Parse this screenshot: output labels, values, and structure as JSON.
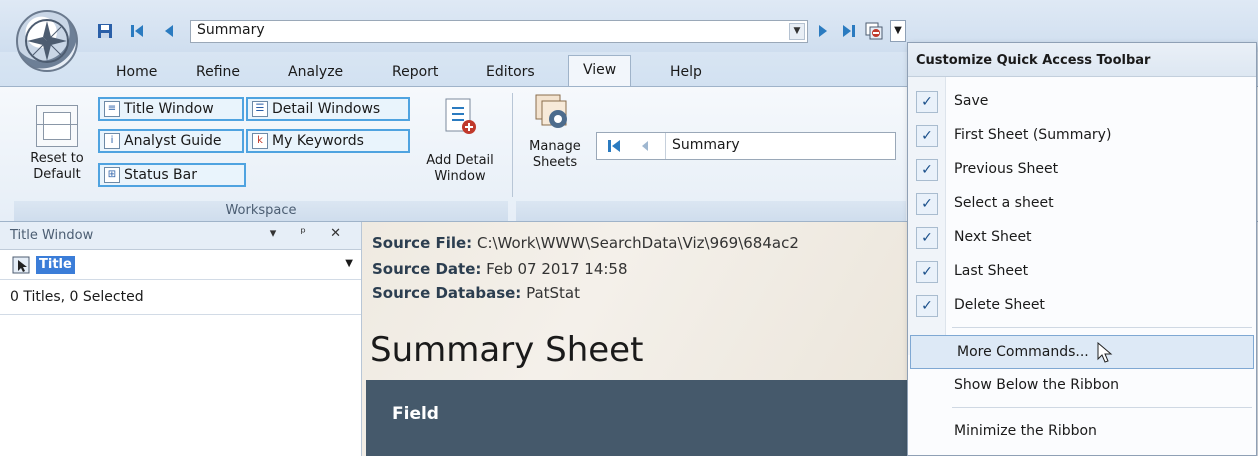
{
  "window": {
    "sheet_selector_value": "Summary"
  },
  "tabs": [
    "Home",
    "Refine",
    "Analyze",
    "Report",
    "Editors",
    "View",
    "Help"
  ],
  "ribbon": {
    "reset_label_1": "Reset to",
    "reset_label_2": "Default",
    "title_window": "Title Window",
    "analyst_guide": "Analyst Guide",
    "status_bar": "Status Bar",
    "detail_windows": "Detail Windows",
    "my_keywords": "My Keywords",
    "add_detail_1": "Add Detail",
    "add_detail_2": "Window",
    "workspace_group": "Workspace",
    "manage_1": "Manage",
    "manage_2": "Sheets",
    "nav_sheet_value": "Summary"
  },
  "left_pane": {
    "header": "Title Window",
    "field_value": "Title",
    "counts": "0 Titles, 0 Selected"
  },
  "content": {
    "source_file_label": "Source File:",
    "source_file_value": "C:\\Work\\WWW\\SearchData\\Viz\\969\\684ac2",
    "source_date_label": "Source Date:",
    "source_date_value": "Feb 07 2017 14:58",
    "source_db_label": "Source Database:",
    "source_db_value": "PatStat",
    "sheet_title": "Summary Sheet",
    "field_header": "Field"
  },
  "menu": {
    "title": "Customize Quick Access Toolbar",
    "checked_items": [
      "Save",
      "First Sheet (Summary)",
      "Previous Sheet",
      "Select a sheet",
      "Next Sheet",
      "Last Sheet",
      "Delete Sheet"
    ],
    "more_commands": "More Commands...",
    "show_below": "Show Below the Ribbon",
    "minimize": "Minimize the Ribbon"
  }
}
